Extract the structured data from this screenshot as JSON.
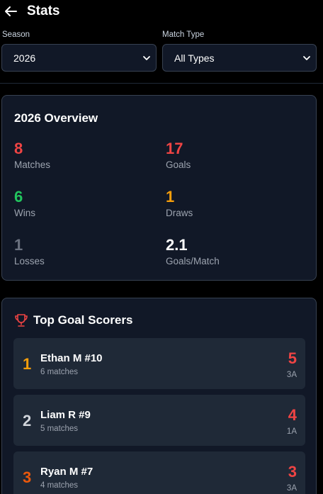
{
  "header": {
    "title": "Stats"
  },
  "filters": {
    "season": {
      "label": "Season",
      "value": "2026"
    },
    "match_type": {
      "label": "Match Type",
      "value": "All Types"
    }
  },
  "overview": {
    "title": "2026 Overview",
    "stats": [
      {
        "value": "8",
        "label": "Matches",
        "color": "#ef4444"
      },
      {
        "value": "17",
        "label": "Goals",
        "color": "#ef4444"
      },
      {
        "value": "6",
        "label": "Wins",
        "color": "#22c55e"
      },
      {
        "value": "1",
        "label": "Draws",
        "color": "#f59e0b"
      },
      {
        "value": "1",
        "label": "Losses",
        "color": "#6b7280"
      },
      {
        "value": "2.1",
        "label": "Goals/Match",
        "color": "#ffffff"
      }
    ]
  },
  "top_scorers": {
    "title": "Top Goal Scorers",
    "icon": "trophy-icon",
    "players": [
      {
        "rank": "1",
        "name": "Ethan M #10",
        "matches": "6 matches",
        "goals": "5",
        "assists": "3A",
        "rank_color": "#f59e0b"
      },
      {
        "rank": "2",
        "name": "Liam R #9",
        "matches": "5 matches",
        "goals": "4",
        "assists": "1A",
        "rank_color": "#d1d5db"
      },
      {
        "rank": "3",
        "name": "Ryan M #7",
        "matches": "4 matches",
        "goals": "3",
        "assists": "3A",
        "rank_color": "#ea580c"
      }
    ]
  }
}
